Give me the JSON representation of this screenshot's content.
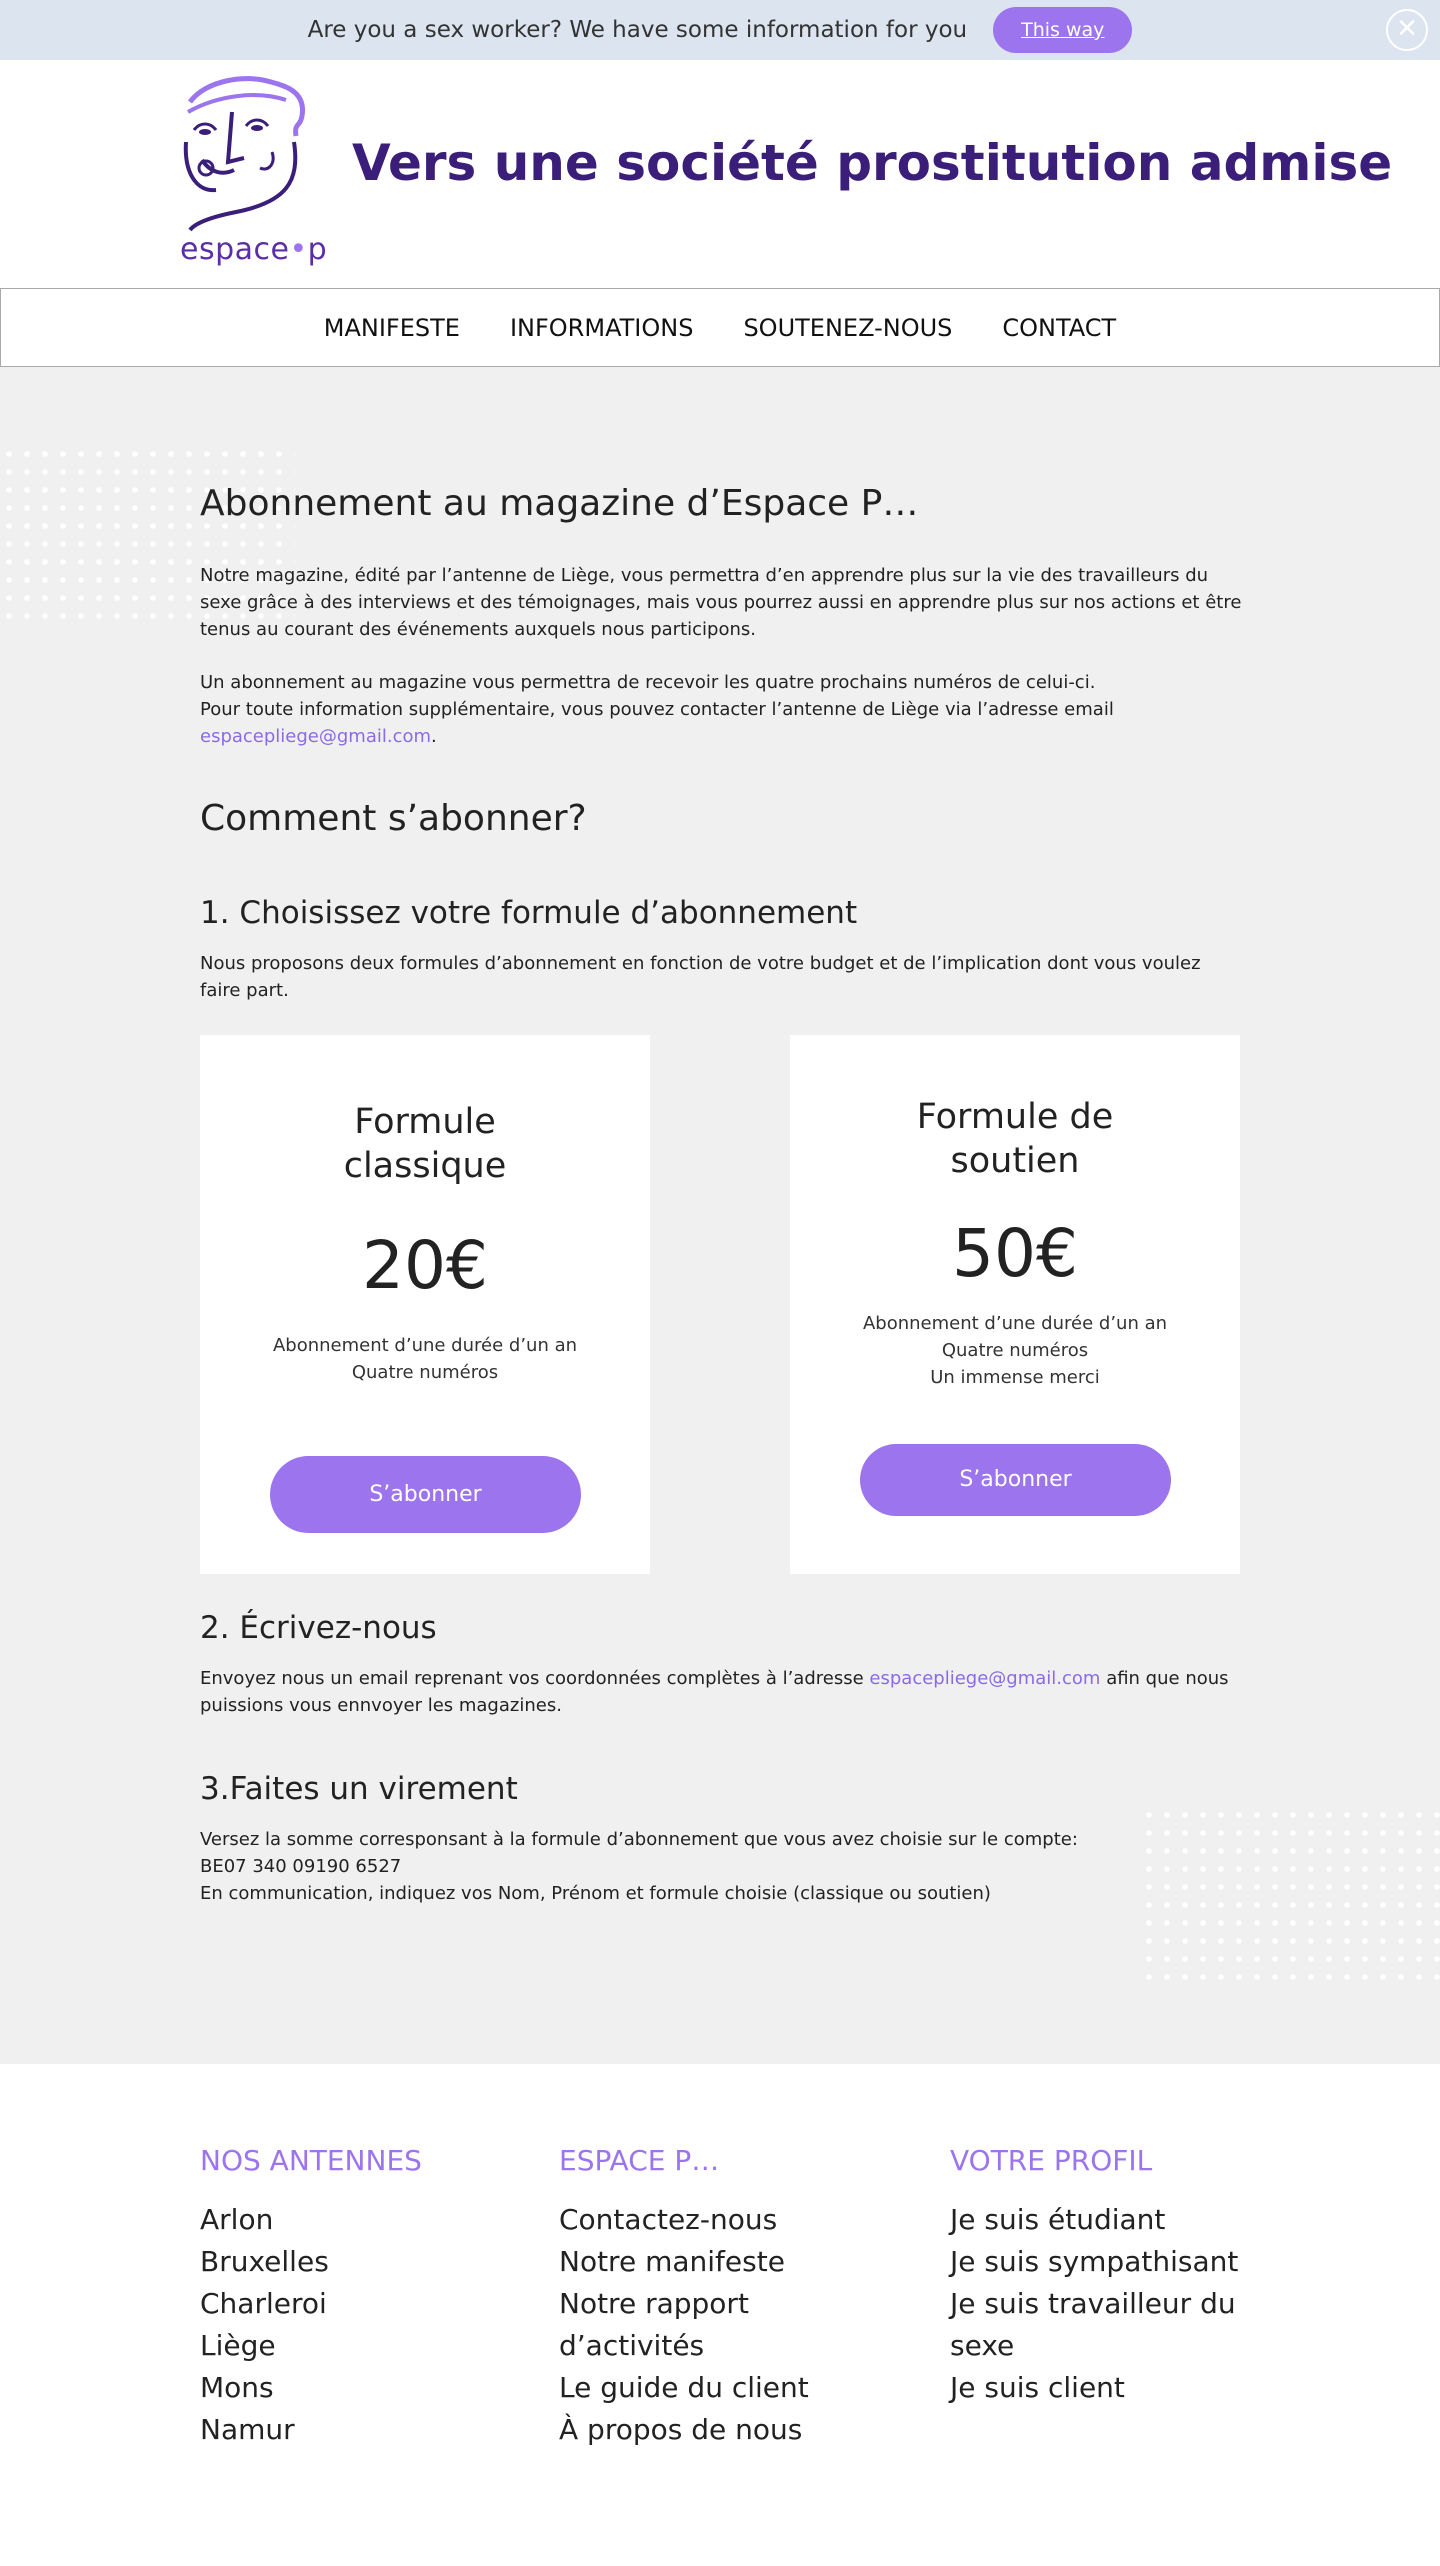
{
  "banner": {
    "text": "Are you a sex worker? We have some information for you",
    "button_label": "This way",
    "close_icon": "close-icon"
  },
  "header": {
    "logo_word": "espace",
    "logo_suffix": "p",
    "title": "Vers une société prostitution admise"
  },
  "nav": {
    "items": [
      "MANIFESTE",
      "INFORMATIONS",
      "SOUTENEZ-NOUS",
      "CONTACT"
    ]
  },
  "main": {
    "title": "Abonnement au magazine d’Espace P…",
    "intro": "Notre magazine, édité par l’antenne de Liège, vous permettra d’en apprendre plus sur la vie des travailleurs du sexe grâce à des interviews et des témoignages, mais vous pourrez aussi en apprendre plus sur nos actions et être tenus au courant des événements auxquels nous participons.",
    "info_line1": "Un abonnement au magazine vous permettra de recevoir les quatre prochains numéros de celui-ci.",
    "info_line2": "Pour toute information supplémentaire, vous pouvez contacter l’antenne de Liège via l’adresse email",
    "email": "espacepliege@gmail.com",
    "period": ".",
    "how_title": "Comment s’abonner?",
    "step1_title": "1. Choisissez votre formule d’abonnement",
    "step1_text": "Nous proposons deux formules d’abonnement en fonction de votre budget et de l’implication dont vous voulez faire part.",
    "cards": [
      {
        "title_line1": "Formule",
        "title_line2": "classique",
        "price": "20€",
        "desc_line1": "Abonnement d’une durée d’un an",
        "desc_line2": "Quatre numéros",
        "desc_line3": "",
        "button": "S’abonner"
      },
      {
        "title_line1": "Formule de",
        "title_line2": "soutien",
        "price": "50€",
        "desc_line1": "Abonnement d’une durée d’un an",
        "desc_line2": "Quatre numéros",
        "desc_line3": "Un immense merci",
        "button": "S’abonner"
      }
    ],
    "step2_title": "2. Écrivez-nous",
    "step2_text_a": "Envoyez nous un email reprenant vos coordonnées complètes à l’adresse",
    "step2_email": "espacepliege@gmail.com",
    "step2_text_b": "afin que nous puissions vous ennvoyer les magazines.",
    "step3_title": "3.Faites un virement",
    "step3_line1": "Versez la somme corresponsant à la formule d’abonnement que vous avez choisie sur le compte:",
    "step3_line2": "BE07 340 09190 6527",
    "step3_line3": "En communication, indiquez vos Nom, Prénom et formule choisie (classique ou soutien)"
  },
  "footer": {
    "columns": [
      {
        "heading": "NOS ANTENNES",
        "links": [
          "Arlon",
          "Bruxelles",
          "Charleroi",
          "Liège",
          "Mons",
          "Namur"
        ]
      },
      {
        "heading": "ESPACE P…",
        "links": [
          "Contactez-nous",
          "Notre manifeste",
          "Notre rapport",
          "d’activités",
          "Le guide du client",
          "À propos de nous"
        ]
      },
      {
        "heading": "VOTRE PROFIL",
        "links": [
          "Je suis étudiant",
          "Je suis sympathisant",
          "Je suis travailleur du",
          "sexe",
          "Je suis client"
        ]
      }
    ]
  },
  "colors": {
    "accent": "#9b74ee",
    "title_purple": "#3a1e7a",
    "banner_bg": "#dbe4ef",
    "page_bg": "#f0f0f0"
  }
}
